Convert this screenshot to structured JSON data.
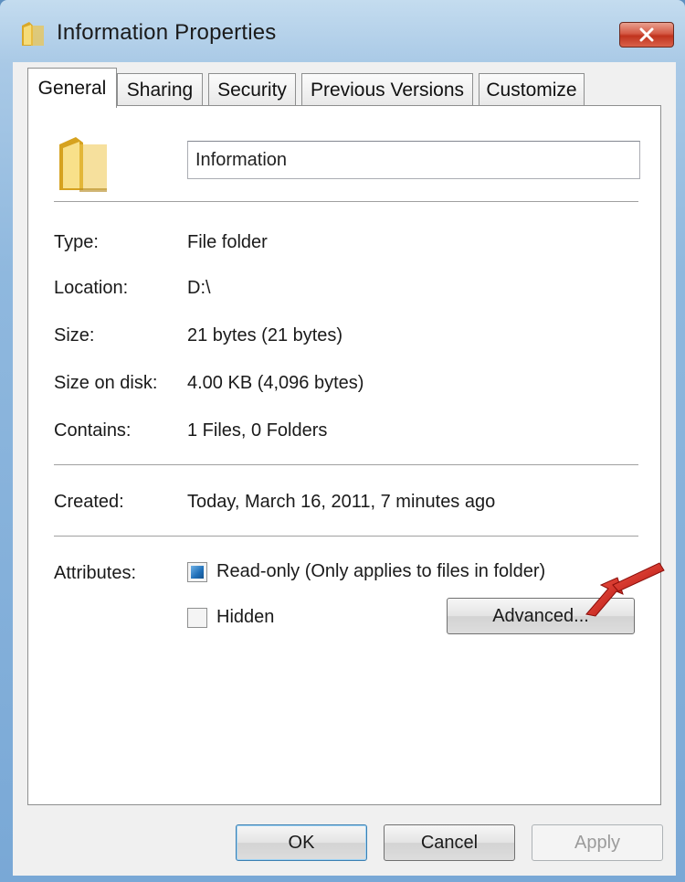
{
  "window": {
    "title": "Information Properties",
    "icons": {
      "title": "folder-icon",
      "close": "close-icon"
    }
  },
  "tabs": [
    {
      "label": "General",
      "active": true
    },
    {
      "label": "Sharing",
      "active": false
    },
    {
      "label": "Security",
      "active": false
    },
    {
      "label": "Previous Versions",
      "active": false
    },
    {
      "label": "Customize",
      "active": false
    }
  ],
  "general": {
    "folder_icon": "folder-icon",
    "name_value": "Information",
    "properties": [
      {
        "label": "Type:",
        "value": "File folder"
      },
      {
        "label": "Location:",
        "value": "D:\\"
      },
      {
        "label": "Size:",
        "value": "21 bytes (21 bytes)"
      },
      {
        "label": "Size on disk:",
        "value": "4.00 KB (4,096 bytes)"
      },
      {
        "label": "Contains:",
        "value": "1 Files, 0 Folders"
      }
    ],
    "created": {
      "label": "Created:",
      "value": "Today, March 16, 2011, 7 minutes ago"
    },
    "attributes": {
      "label": "Attributes:",
      "readonly": {
        "label": "Read-only (Only applies to files in folder)",
        "state": "indeterminate"
      },
      "hidden": {
        "label": "Hidden",
        "state": "unchecked"
      },
      "advanced_label": "Advanced..."
    }
  },
  "buttons": {
    "ok": "OK",
    "cancel": "Cancel",
    "apply": "Apply"
  },
  "annotation": {
    "arrow_color": "#d8261c",
    "icon": "red-arrow-icon"
  },
  "colors": {
    "folder": "#f2cf57",
    "readonly_check": "#1f6fb8",
    "close": "#c7402b"
  }
}
